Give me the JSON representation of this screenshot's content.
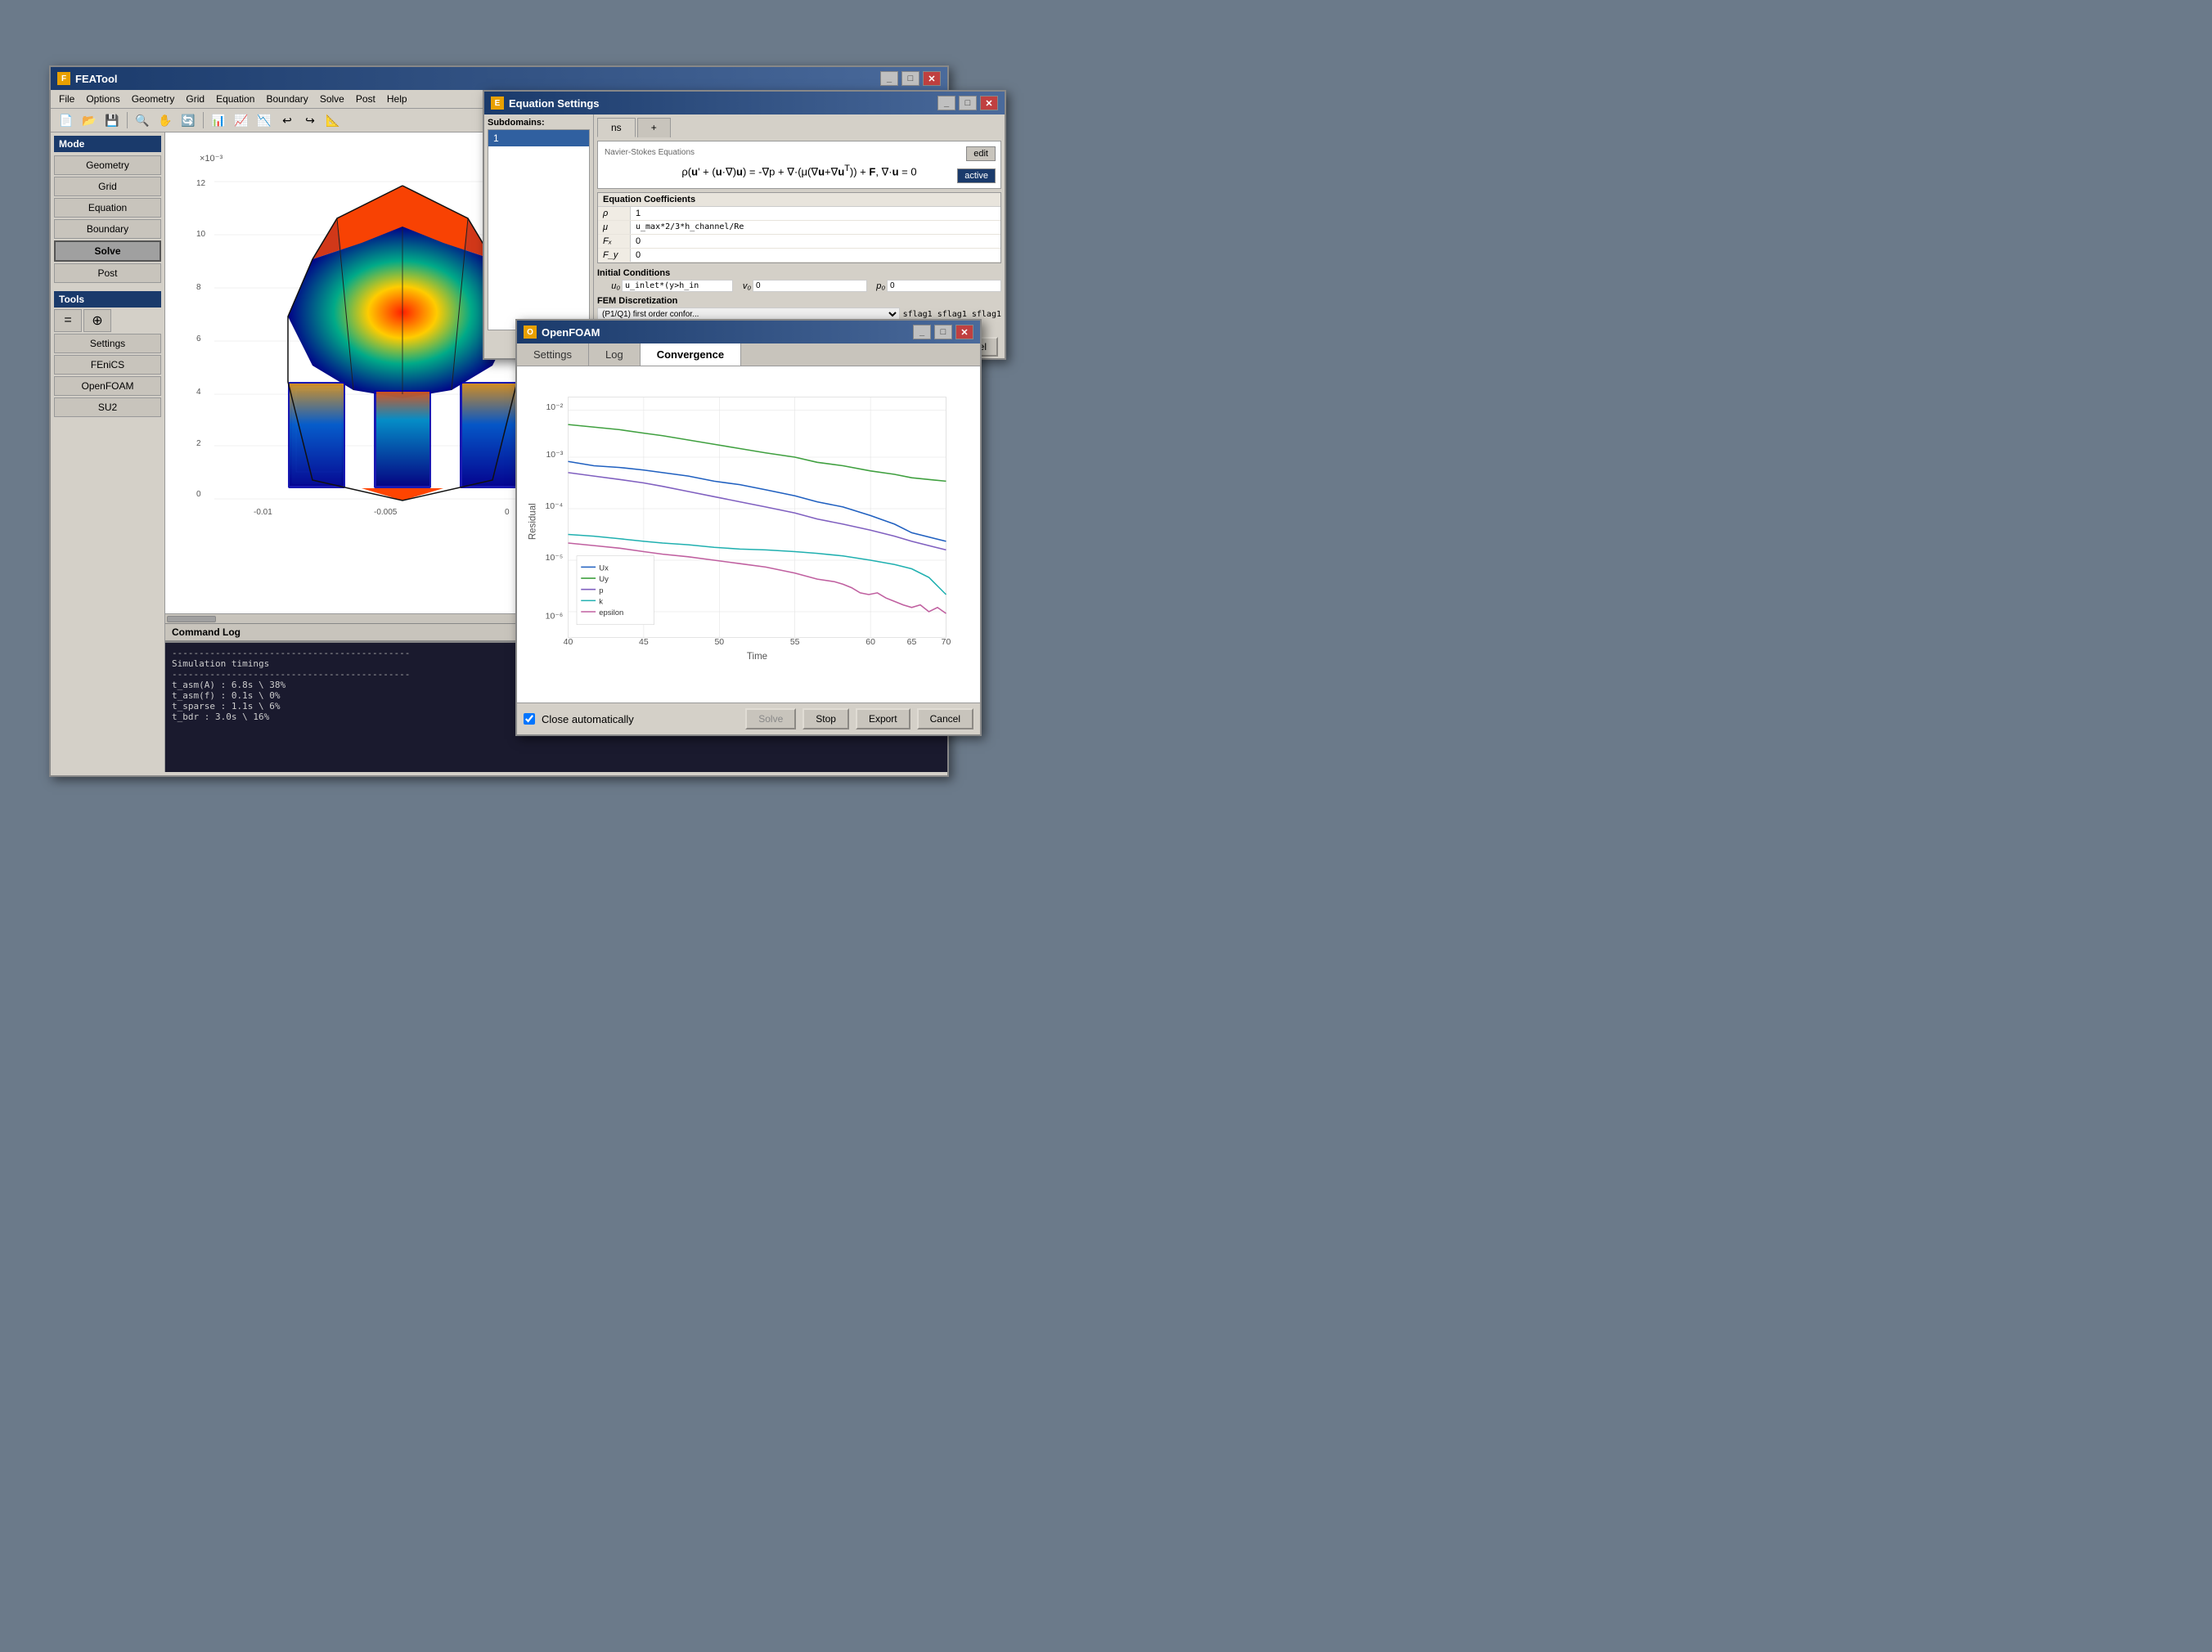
{
  "mainWindow": {
    "title": "FEATool",
    "icon": "F",
    "menuItems": [
      "File",
      "Options",
      "Geometry",
      "Grid",
      "Equation",
      "Boundary",
      "Solve",
      "Post",
      "Help"
    ],
    "toolbar": {
      "buttons": [
        "📄",
        "📂",
        "💾",
        "🔍",
        "✋",
        "🔄",
        "📊",
        "📈",
        "📉",
        "↩",
        "↪",
        "📐"
      ]
    },
    "sidebar": {
      "modeLabel": "Mode",
      "buttons": [
        "Geometry",
        "Grid",
        "Equation",
        "Boundary",
        "Solve",
        "Post"
      ],
      "activeButton": "Solve",
      "toolsLabel": "Tools",
      "toolsIconBtn1": "=",
      "toolsIconBtn2": "⊕",
      "toolsTextBtns": [
        "Settings",
        "FEniCS",
        "OpenFOAM",
        "SU2"
      ]
    },
    "plot": {
      "xAxisLabel": "×10⁻³",
      "xMin": "-0.01",
      "xMax": "0",
      "xMid": "-0.005",
      "yMin": "0",
      "yMax": "12",
      "yTicks": [
        "2",
        "4",
        "6",
        "8",
        "10",
        "12"
      ]
    },
    "commandLog": {
      "header": "Command Log",
      "lines": [
        "--------------------------------------------",
        "Simulation timings",
        "--------------------------------------------",
        "t_asm(A) :           6.8s \\  38%",
        "t_asm(f) :           0.1s \\   0%",
        "t_sparse :           1.1s \\   6%",
        "t_bdr    :           3.0s \\  16%"
      ]
    }
  },
  "equationWindow": {
    "title": "Equation Settings",
    "subdomainsLabel": "Subdomains:",
    "subdomainItem": "1",
    "tabs": [
      "ns",
      "+"
    ],
    "activeTab": "ns",
    "equationsTitle": "Navier-Stokes Equations",
    "formula": "ρ(u' + (u·∇)u) = -∇p + ∇·(μ(∇u+∇uᵀ)) + F, ∇·u = 0",
    "editBtn": "edit",
    "activeBtn": "active",
    "coefficientsLabel": "Equation Coefficients",
    "coefficients": [
      {
        "label": "ρ",
        "value": "1"
      },
      {
        "label": "μ",
        "value": "u_max*2/3*h_channel/Re"
      },
      {
        "label": "Fₓ",
        "value": "0"
      },
      {
        "label": "F_y",
        "value": "0"
      }
    ],
    "initialConditionsLabel": "Initial Conditions",
    "ic": {
      "u0Label": "u₀",
      "u0Value": "u_inlet*(y>h_in",
      "v0Label": "v₀",
      "v0Value": "0",
      "p0Label": "p₀",
      "p0Value": "0"
    },
    "femLabel": "FEM Discretization",
    "femSelect": "(P1/Q1) first order confor...",
    "femFlags": "sflag1 sflag1 sflag1",
    "cancelBtn": "Cancel"
  },
  "openfoamWindow": {
    "title": "OpenFOAM",
    "tabs": [
      "Settings",
      "Log",
      "Convergence"
    ],
    "activeTab": "Convergence",
    "chart": {
      "xLabel": "Time",
      "yLabel": "Residual",
      "xMin": 40,
      "xMax": 70,
      "xTicks": [
        40,
        45,
        50,
        55,
        60,
        65,
        70
      ],
      "yLabels": [
        "10⁻²",
        "10⁻³",
        "10⁻⁴",
        "10⁻⁵",
        "10⁻⁶"
      ],
      "legend": [
        {
          "label": "Ux",
          "color": "#2060c0"
        },
        {
          "label": "Uy",
          "color": "#40a040"
        },
        {
          "label": "p",
          "color": "#8060c0"
        },
        {
          "label": "k",
          "color": "#20b0b0"
        },
        {
          "label": "epsilon",
          "color": "#c060a0"
        }
      ]
    },
    "closeAutomatically": "Close automatically",
    "buttons": {
      "solve": "Solve",
      "stop": "Stop",
      "export": "Export",
      "cancel": "Cancel"
    }
  }
}
